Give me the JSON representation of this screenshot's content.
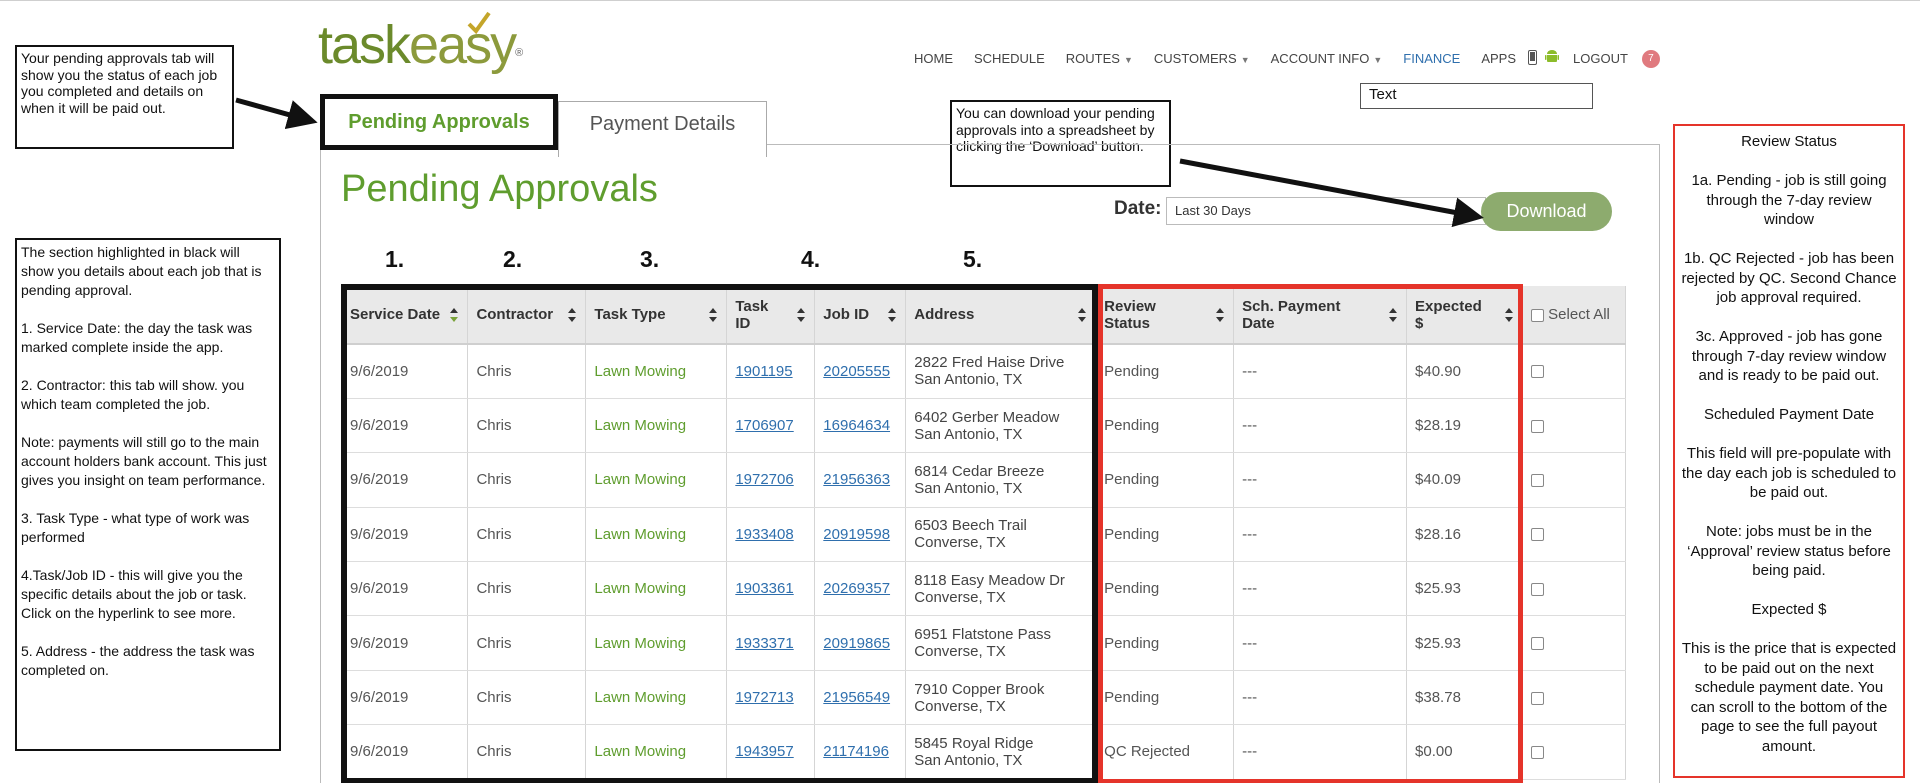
{
  "brand": {
    "name_part1": "task",
    "name_part2": "easy",
    "trademark": "®"
  },
  "nav": {
    "items": [
      {
        "label": "HOME",
        "caret": false,
        "active": false
      },
      {
        "label": "SCHEDULE",
        "caret": false,
        "active": false
      },
      {
        "label": "ROUTES",
        "caret": true,
        "active": false
      },
      {
        "label": "CUSTOMERS",
        "caret": true,
        "active": false
      },
      {
        "label": "ACCOUNT INFO",
        "caret": true,
        "active": false
      },
      {
        "label": "FINANCE",
        "caret": false,
        "active": true
      },
      {
        "label": "APPS",
        "caret": false,
        "active": false
      }
    ],
    "logout_label": "LOGOUT",
    "notification_count": "7",
    "icons": [
      "phone-icon",
      "android-icon",
      "notification-badge"
    ]
  },
  "text_field": {
    "value": "Text"
  },
  "callouts": {
    "pending_tab_note": "Your pending approvals tab will show you the status of each job you completed and details on when it will be paid out.",
    "download_note": "You can download your pending approvals into a spreadsheet by clicking the ‘Download’ button.",
    "section_note": [
      "The section highlighted in black will show you details about each job that is pending approval.",
      "1. Service Date: the day the task was marked complete inside the app.",
      "2. Contractor: this tab will show. you which team completed the job.",
      "Note: payments will still go to the main account holders bank account. This just gives you insight on team performance.",
      "3. Task Type - what type of work was performed",
      "4.Task/Job ID - this will give you the specific details about the job or task. Click on the hyperlink to see more.",
      "5. Address - the address the task was completed on."
    ],
    "review_note": [
      "Review Status",
      "1a. Pending - job is still going through the 7-day review window",
      "1b. QC Rejected - job has been rejected by QC. Second Chance job approval required.",
      "3c. Approved - job has gone through 7-day review window and is ready to be paid out.",
      "Scheduled Payment Date",
      "This field will pre-populate with the day each job is scheduled to be paid out.",
      "Note: jobs must be in the ‘Approval’ review status before being paid.",
      "Expected $",
      "This is the price that is expected to be paid out on the next schedule payment date. You can scroll to the bottom of the page to see the full payout amount."
    ]
  },
  "tabs": {
    "pending": "Pending Approvals",
    "payment": "Payment Details"
  },
  "page_title": "Pending Approvals",
  "filter": {
    "date_label": "Date:",
    "date_value": "Last 30 Days"
  },
  "download_label": "Download",
  "column_numbers": [
    "1.",
    "2.",
    "3.",
    "4.",
    "5."
  ],
  "table": {
    "headers": {
      "service_date": "Service Date",
      "contractor": "Contractor",
      "task_type": "Task Type",
      "task_id": "Task ID",
      "job_id": "Job ID",
      "address": "Address",
      "review_status": "Review Status",
      "sch_payment_date": "Sch. Payment Date",
      "expected": "Expected $",
      "select_all": "Select All"
    },
    "rows": [
      {
        "service_date": "9/6/2019",
        "contractor": "Chris",
        "task_type": "Lawn Mowing",
        "task_id": "1901195",
        "job_id": "20205555",
        "address1": "2822 Fred Haise Drive",
        "address2": "San Antonio, TX",
        "review_status": "Pending",
        "sch_payment_date": "---",
        "expected": "$40.90"
      },
      {
        "service_date": "9/6/2019",
        "contractor": "Chris",
        "task_type": "Lawn Mowing",
        "task_id": "1706907",
        "job_id": "16964634",
        "address1": "6402 Gerber Meadow",
        "address2": "San Antonio, TX",
        "review_status": "Pending",
        "sch_payment_date": "---",
        "expected": "$28.19"
      },
      {
        "service_date": "9/6/2019",
        "contractor": "Chris",
        "task_type": "Lawn Mowing",
        "task_id": "1972706",
        "job_id": "21956363",
        "address1": "6814 Cedar Breeze",
        "address2": "San Antonio, TX",
        "review_status": "Pending",
        "sch_payment_date": "---",
        "expected": "$40.09"
      },
      {
        "service_date": "9/6/2019",
        "contractor": "Chris",
        "task_type": "Lawn Mowing",
        "task_id": "1933408",
        "job_id": "20919598",
        "address1": "6503 Beech Trail",
        "address2": "Converse, TX",
        "review_status": "Pending",
        "sch_payment_date": "---",
        "expected": "$28.16"
      },
      {
        "service_date": "9/6/2019",
        "contractor": "Chris",
        "task_type": "Lawn Mowing",
        "task_id": "1903361",
        "job_id": "20269357",
        "address1": "8118 Easy Meadow Dr",
        "address2": "Converse, TX",
        "review_status": "Pending",
        "sch_payment_date": "---",
        "expected": "$25.93"
      },
      {
        "service_date": "9/6/2019",
        "contractor": "Chris",
        "task_type": "Lawn Mowing",
        "task_id": "1933371",
        "job_id": "20919865",
        "address1": "6951 Flatstone Pass",
        "address2": "Converse, TX",
        "review_status": "Pending",
        "sch_payment_date": "---",
        "expected": "$25.93"
      },
      {
        "service_date": "9/6/2019",
        "contractor": "Chris",
        "task_type": "Lawn Mowing",
        "task_id": "1972713",
        "job_id": "21956549",
        "address1": "7910 Copper Brook",
        "address2": "Converse, TX",
        "review_status": "Pending",
        "sch_payment_date": "---",
        "expected": "$38.78"
      },
      {
        "service_date": "9/6/2019",
        "contractor": "Chris",
        "task_type": "Lawn Mowing",
        "task_id": "1943957",
        "job_id": "21174196",
        "address1": "5845 Royal Ridge",
        "address2": "San Antonio, TX",
        "review_status": "QC Rejected",
        "sch_payment_date": "---",
        "expected": "$0.00"
      }
    ]
  },
  "colors": {
    "brand_green": "#5f9d2e",
    "link_blue": "#2f6fad",
    "highlight_red": "#e5342a",
    "download_green": "#8dab6e"
  }
}
